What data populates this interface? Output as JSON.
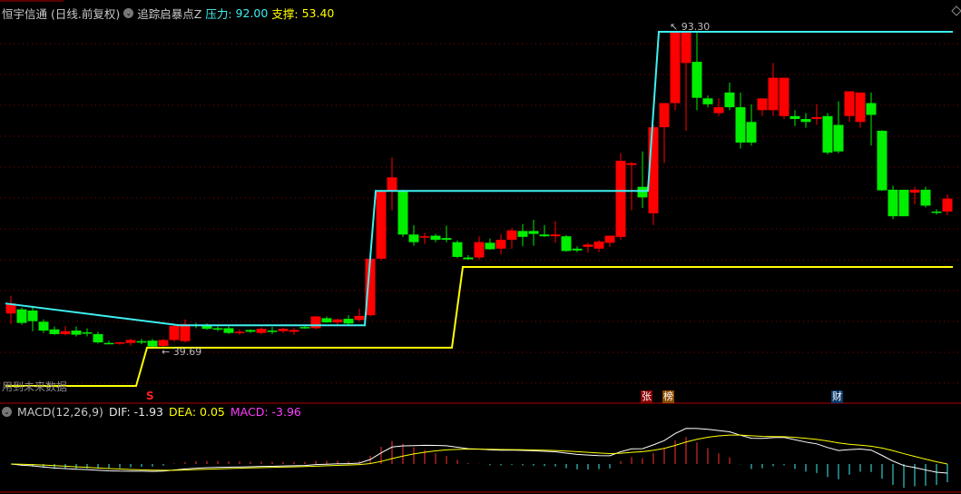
{
  "header": {
    "stock": "恒宇信通",
    "period": "(日线.前复权)",
    "indicator": "追踪启暴点Z",
    "resistance_label": "压力:",
    "resistance_value": "92.00",
    "support_label": "支撑:",
    "support_value": "53.40"
  },
  "warning": "用到未来数据",
  "markers": {
    "s": "S",
    "zhang": "张",
    "bang": "榜",
    "cai": "财"
  },
  "labels": {
    "high": "93.30",
    "low": "39.69"
  },
  "macd": {
    "name": "MACD(12,26,9)",
    "dif": "DIF: -1.93",
    "dea": "DEA: 0.05",
    "macd": "MACD: -3.96"
  },
  "colors": {
    "up": "#ff0000",
    "down": "#00ee00",
    "resistance": "#3ff0f0",
    "support": "#ffff00",
    "grid": "#8b0000"
  },
  "chart_data": {
    "type": "candlestick",
    "price_range": [
      33.0,
      94.5
    ],
    "ohlc": [
      [
        45.5,
        48.5,
        43.7,
        47.2
      ],
      [
        46.2,
        46.5,
        43.6,
        43.9
      ],
      [
        46.0,
        46.8,
        42.5,
        44.2
      ],
      [
        44.1,
        44.5,
        42.2,
        42.6
      ],
      [
        42.8,
        43.3,
        41.9,
        42.0
      ],
      [
        42.0,
        43.4,
        41.8,
        42.5
      ],
      [
        42.6,
        43.3,
        41.6,
        41.9
      ],
      [
        42.3,
        43.0,
        41.6,
        42.1
      ],
      [
        42.0,
        42.4,
        40.4,
        40.6
      ],
      [
        40.5,
        40.9,
        40.3,
        40.45
      ],
      [
        40.4,
        40.7,
        40.2,
        40.6
      ],
      [
        40.5,
        41.2,
        40.0,
        41.0
      ],
      [
        40.8,
        41.2,
        40.3,
        40.6
      ],
      [
        40.9,
        41.2,
        39.69,
        39.9
      ],
      [
        40.0,
        41.2,
        39.7,
        41.0
      ],
      [
        41.0,
        43.6,
        40.7,
        43.4
      ],
      [
        40.8,
        44.5,
        40.6,
        43.7
      ],
      [
        43.6,
        43.9,
        43.0,
        43.4
      ],
      [
        43.4,
        43.8,
        42.7,
        42.9
      ],
      [
        43.0,
        43.3,
        42.5,
        42.8
      ],
      [
        43.0,
        43.3,
        42.0,
        42.2
      ],
      [
        42.2,
        42.8,
        41.9,
        42.4
      ],
      [
        42.7,
        42.8,
        42.2,
        42.4
      ],
      [
        42.2,
        43.1,
        42.0,
        42.9
      ],
      [
        42.6,
        43.2,
        42.0,
        42.4
      ],
      [
        42.5,
        43.0,
        42.2,
        42.9
      ],
      [
        42.4,
        43.0,
        41.9,
        42.7
      ],
      [
        43.2,
        43.5,
        42.9,
        43.1
      ],
      [
        43.0,
        45.1,
        42.8,
        45.0
      ],
      [
        44.7,
        45.0,
        43.9,
        44.0
      ],
      [
        44.0,
        44.6,
        43.5,
        44.5
      ],
      [
        44.6,
        45.2,
        43.4,
        43.8
      ],
      [
        44.4,
        46.3,
        44.2,
        45.1
      ],
      [
        45.2,
        55.0,
        45.0,
        54.8
      ],
      [
        54.8,
        66.5,
        54.5,
        66.3
      ],
      [
        66.3,
        72.0,
        63.0,
        68.6
      ],
      [
        66.3,
        66.5,
        58.5,
        58.9
      ],
      [
        58.9,
        60.5,
        57.0,
        57.6
      ],
      [
        58.5,
        59.2,
        57.3,
        58.6
      ],
      [
        58.7,
        59.0,
        57.6,
        58.0
      ],
      [
        58.3,
        60.4,
        57.6,
        58.0
      ],
      [
        57.6,
        57.9,
        54.9,
        55.1
      ],
      [
        55.0,
        55.4,
        54.6,
        54.7
      ],
      [
        55.0,
        58.6,
        54.6,
        57.6
      ],
      [
        57.5,
        58.2,
        56.3,
        56.4
      ],
      [
        56.5,
        59.0,
        55.5,
        58.0
      ],
      [
        58.0,
        60.0,
        56.5,
        59.6
      ],
      [
        59.5,
        60.7,
        56.9,
        58.5
      ],
      [
        59.5,
        61.4,
        57.0,
        59.0
      ],
      [
        58.9,
        60.5,
        58.5,
        58.6
      ],
      [
        58.6,
        61.2,
        57.5,
        58.9
      ],
      [
        58.6,
        58.8,
        56.0,
        56.1
      ],
      [
        56.5,
        56.9,
        55.9,
        56.2
      ],
      [
        56.8,
        57.5,
        55.8,
        57.2
      ],
      [
        56.5,
        57.9,
        55.9,
        57.7
      ],
      [
        57.5,
        58.7,
        56.8,
        58.7
      ],
      [
        58.5,
        72.7,
        58.0,
        71.4
      ],
      [
        70.7,
        71.2,
        63.0,
        71.0
      ],
      [
        67.0,
        73.0,
        63.4,
        65.2
      ],
      [
        62.5,
        77.5,
        60.5,
        77.1
      ],
      [
        77.1,
        80.5,
        71.0,
        81.2
      ],
      [
        81.2,
        93.3,
        80.0,
        93.3
      ],
      [
        88.0,
        93.5,
        76.5,
        93.2
      ],
      [
        88.2,
        93.3,
        80.0,
        82.1
      ],
      [
        82.0,
        82.5,
        80.5,
        81.0
      ],
      [
        79.5,
        82.0,
        79.0,
        80.5
      ],
      [
        83.0,
        84.7,
        80.0,
        80.5
      ],
      [
        80.5,
        83.0,
        73.5,
        74.5
      ],
      [
        78.0,
        81.0,
        74.0,
        74.5
      ],
      [
        80.0,
        82.0,
        79.0,
        82.0
      ],
      [
        80.0,
        88.0,
        79.0,
        85.5
      ],
      [
        79.0,
        85.5,
        78.5,
        85.5
      ],
      [
        79.0,
        80.0,
        77.3,
        78.5
      ],
      [
        78.5,
        79.5,
        77.0,
        78.0
      ],
      [
        78.5,
        81.0,
        77.5,
        78.8
      ],
      [
        79.0,
        79.5,
        72.5,
        72.8
      ],
      [
        77.5,
        81.5,
        72.7,
        73.0
      ],
      [
        79.0,
        83.0,
        78.0,
        83.2
      ],
      [
        78.0,
        82.5,
        77.0,
        83.0
      ],
      [
        81.2,
        83.0,
        74.0,
        79.2
      ],
      [
        76.5,
        76.6,
        66.3,
        66.4
      ],
      [
        66.5,
        67.2,
        61.5,
        62.0
      ],
      [
        66.5,
        66.5,
        62.0,
        62.0
      ],
      [
        66.0,
        67.0,
        64.0,
        66.5
      ],
      [
        66.5,
        67.0,
        63.5,
        63.8
      ],
      [
        62.8,
        63.2,
        62.3,
        62.6
      ],
      [
        62.8,
        65.7,
        62.2,
        65.0
      ]
    ],
    "resistance_steps": [
      [
        0,
        47.2
      ],
      [
        16,
        43.5
      ],
      [
        33,
        43.5
      ],
      [
        34,
        66.3
      ],
      [
        59,
        66.3
      ],
      [
        60,
        93.3
      ],
      [
        86,
        93.3
      ]
    ],
    "support_steps": [
      [
        0,
        33.2
      ],
      [
        12,
        33.2
      ],
      [
        13,
        39.7
      ],
      [
        41,
        39.7
      ],
      [
        42,
        53.4
      ],
      [
        86,
        53.4
      ]
    ]
  }
}
